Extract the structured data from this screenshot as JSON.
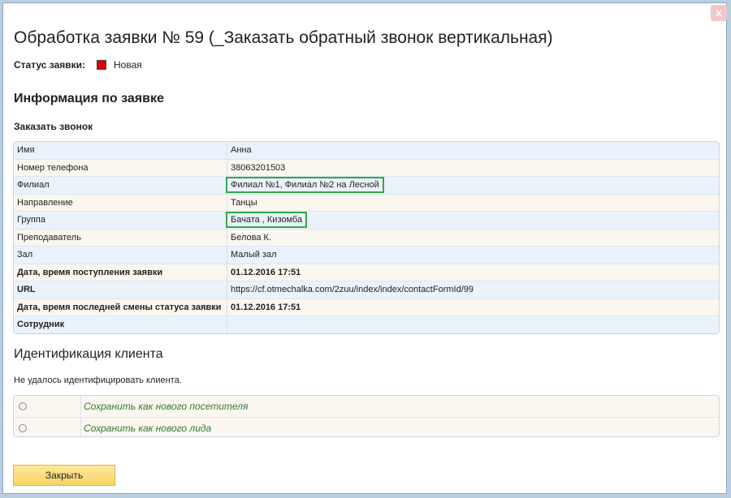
{
  "dialog": {
    "title": "Обработка заявки № 59 (_Заказать обратный звонок вертикальная)",
    "close_icon_label": "x"
  },
  "status": {
    "label": "Статус заявки:",
    "value": "Новая",
    "color": "#e00000"
  },
  "info": {
    "heading": "Информация по заявке",
    "subheading": "Заказать звонок",
    "rows": [
      {
        "key": "Имя",
        "value": "Анна"
      },
      {
        "key": "Номер телефона",
        "value": "38063201503"
      },
      {
        "key": "Филиал",
        "value": "Филиал №1, Филиал №2 на Лесной"
      },
      {
        "key": "Направление",
        "value": "Танцы"
      },
      {
        "key": "Группа",
        "value": "Бачата , Кизомба"
      },
      {
        "key": "Преподаватель",
        "value": "Белова К."
      },
      {
        "key": "Зал",
        "value": "Малый зал"
      },
      {
        "key": "Дата, время поступления заявки",
        "value": "01.12.2016 17:51"
      },
      {
        "key": "URL",
        "value": "https://cf.otmechalka.com/2zuu/index/index/contactFormId/99"
      },
      {
        "key": "Дата, время последней смены статуса заявки",
        "value": "01.12.2016 17:51"
      },
      {
        "key": "Сотрудник",
        "value": ""
      }
    ]
  },
  "identification": {
    "heading": "Идентификация клиента",
    "note": "Не удалось идентифицировать клиента.",
    "options": [
      {
        "label": "Сохранить как нового посетителя"
      },
      {
        "label": "Сохранить как нового лида"
      }
    ]
  },
  "footer": {
    "close_button": "Закрыть"
  },
  "colors": {
    "highlight_border": "#2fa84a",
    "link": "#2f7d2f",
    "button_bg": "#f6d466"
  }
}
